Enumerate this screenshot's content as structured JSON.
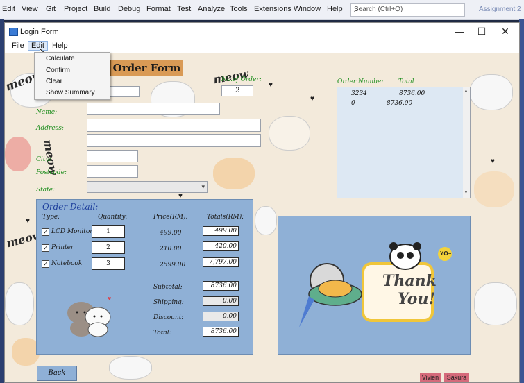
{
  "ide": {
    "menu": [
      "Edit",
      "View",
      "Git",
      "Project",
      "Build",
      "Debug",
      "Format",
      "Test",
      "Analyze",
      "Tools",
      "Extensions",
      "Window",
      "Help"
    ],
    "search_placeholder": "Search (Ctrl+Q)",
    "assignment_label": "Assignment 2"
  },
  "window": {
    "title": "Login Form",
    "minimize": "—",
    "maximize": "☐",
    "close": "✕"
  },
  "menustrip": {
    "items": [
      "File",
      "Edit",
      "Help"
    ],
    "edit_dropdown": [
      "Calculate",
      "Confirm",
      "Clear",
      "Show Summary"
    ]
  },
  "form": {
    "heading": "Order Form",
    "no_of_order_label": "No.of Order:",
    "no_of_order_value": "2",
    "name_label": "Name:",
    "address_label": "Address:",
    "city_label": "City:",
    "postcode_label": "Postcode:",
    "state_label": "State:",
    "meow_label": "meow"
  },
  "orders_list": {
    "headers": [
      "Order Number",
      "Total"
    ],
    "rows": [
      {
        "number": "3234",
        "total": "8736.00"
      },
      {
        "number": "0",
        "total": "8736.00"
      }
    ]
  },
  "order_detail": {
    "title": "Order Detail:",
    "col_type": "Type:",
    "col_quantity": "Quantity:",
    "col_price": "Price(RM):",
    "col_totals": "Totals(RM):",
    "items": [
      {
        "name": "LCD Monitor",
        "checked": true,
        "quantity": "1",
        "price": "499.00",
        "total": "499.00"
      },
      {
        "name": "Printer",
        "checked": true,
        "quantity": "2",
        "price": "210.00",
        "total": "420.00"
      },
      {
        "name": "Notebook",
        "checked": true,
        "quantity": "3",
        "price": "2599.00",
        "total": "7,797.00"
      }
    ],
    "subtotal_label": "Subtotal:",
    "subtotal": "8736.00",
    "shipping_label": "Shipping:",
    "shipping": "0.00",
    "discount_label": "Discount:",
    "discount": "0.00",
    "total_label": "Total:",
    "total": "8736.00"
  },
  "thank_you": {
    "line1": "Thank",
    "line2": "You!",
    "yo": "YO~"
  },
  "back_button": "Back",
  "footer_names": [
    "Vivien",
    "Sakura"
  ],
  "colors": {
    "panel_blue": "#8fb0d6",
    "label_green": "#1c8d1c",
    "title_orange": "#d99a55",
    "badge_pink": "#d56a7b"
  }
}
